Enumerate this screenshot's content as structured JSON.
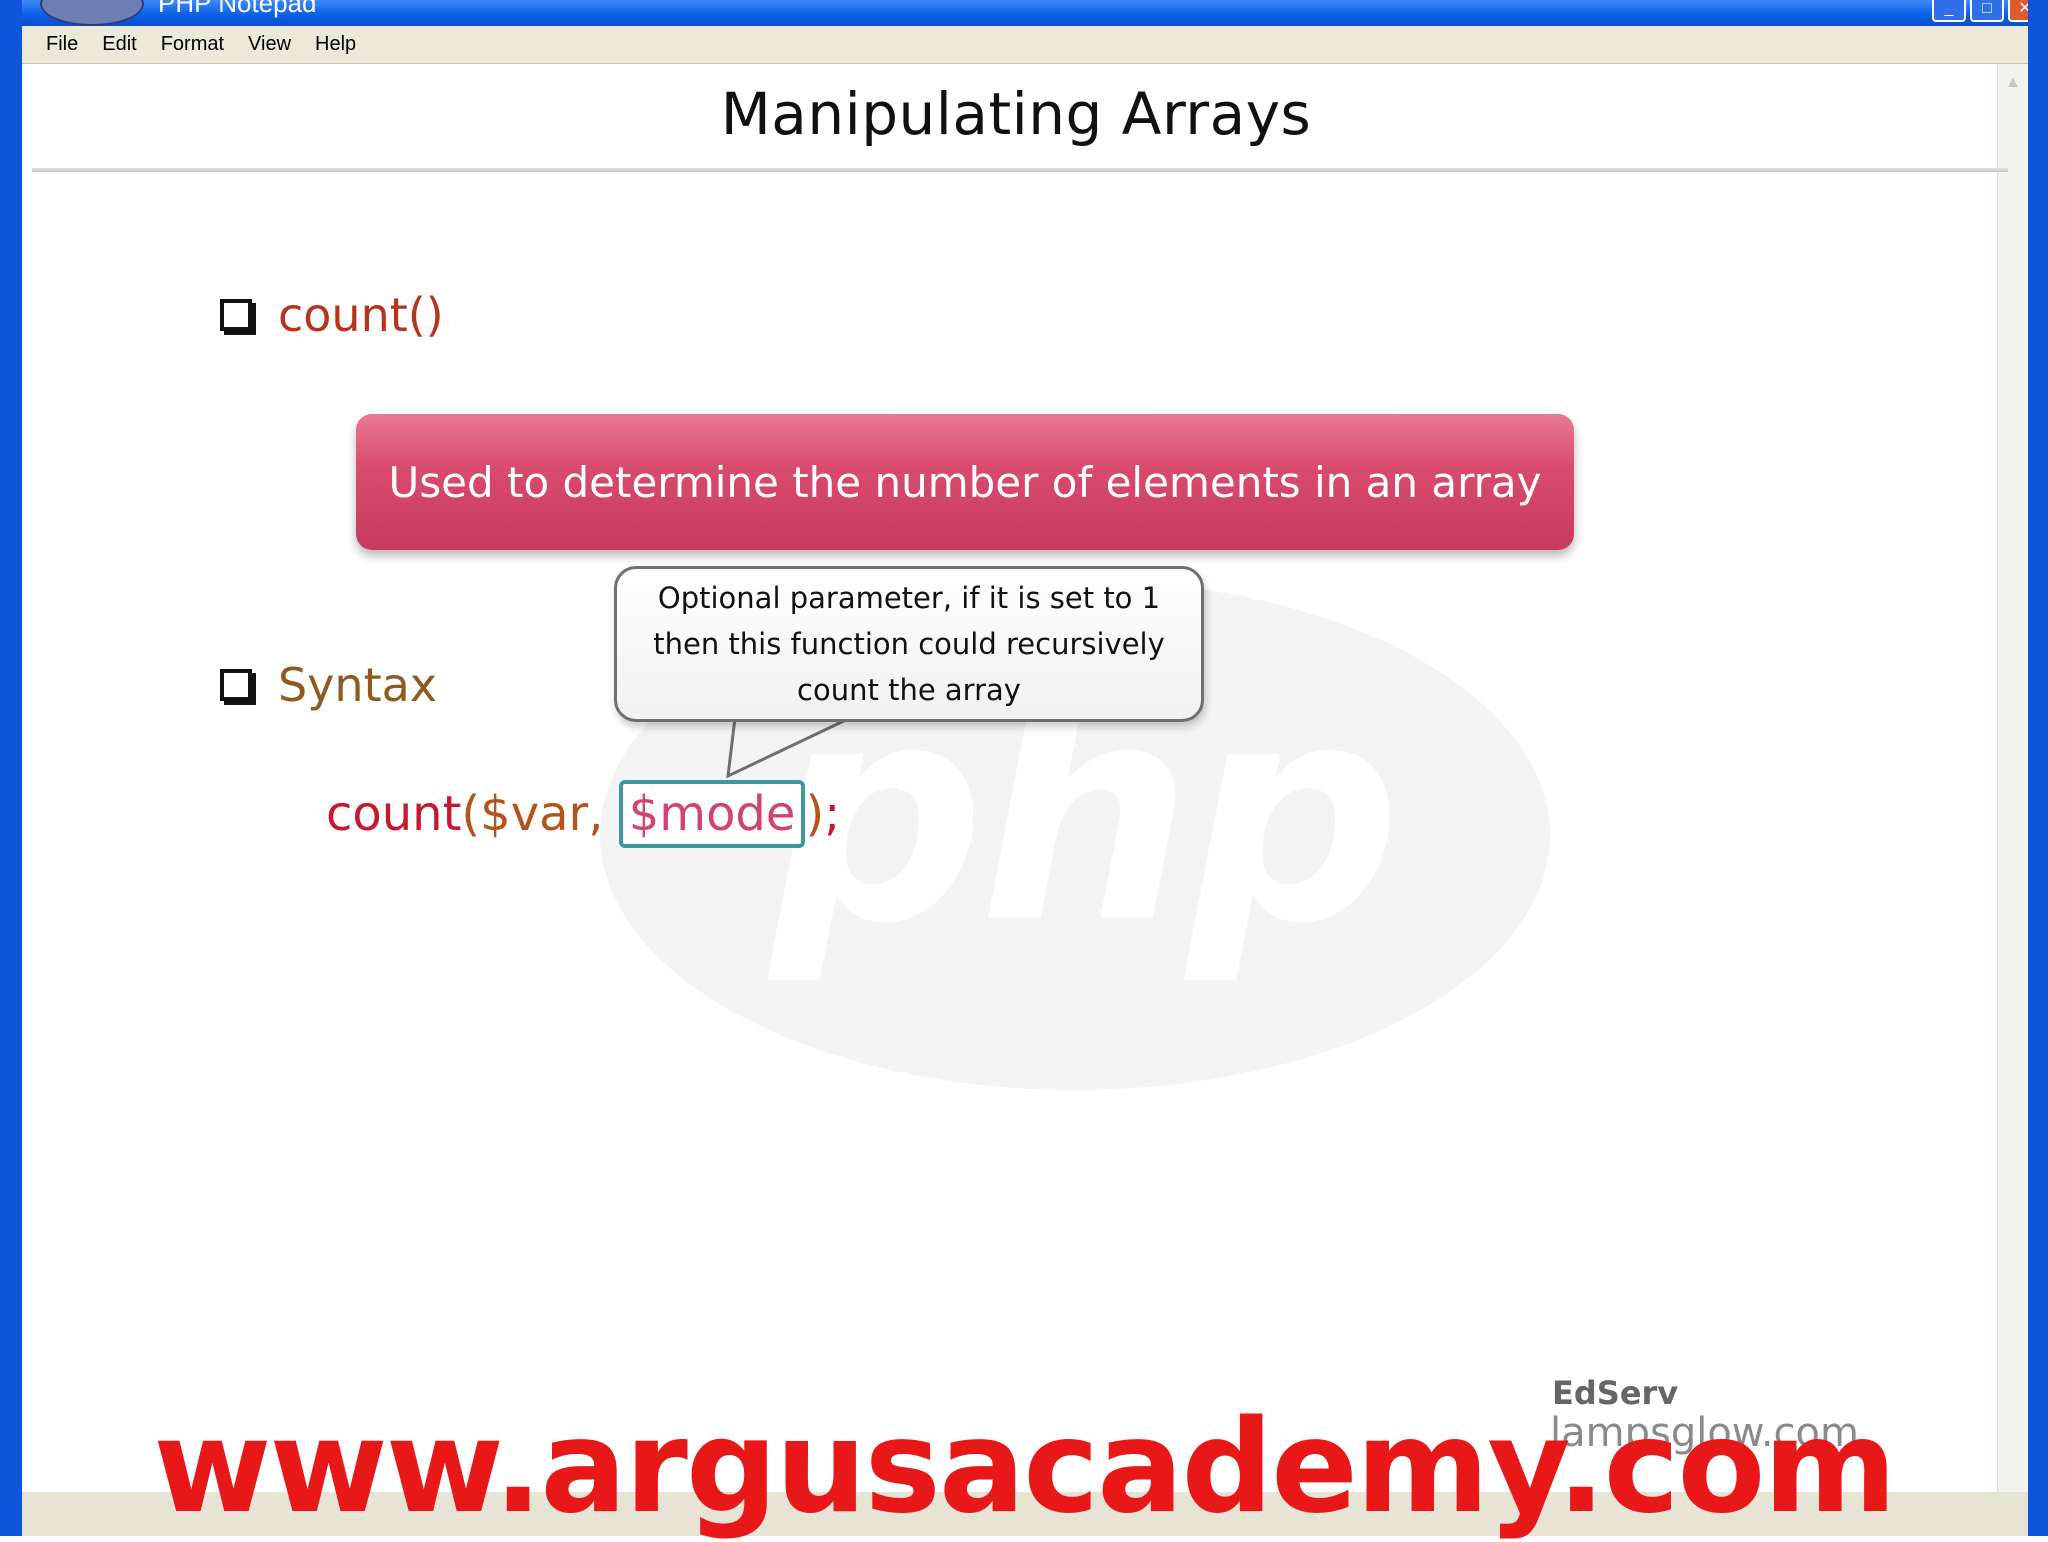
{
  "window": {
    "title": "PHP Notepad",
    "controls": [
      "_",
      "□",
      "✕"
    ]
  },
  "menubar": {
    "items": [
      "File",
      "Edit",
      "Format",
      "View",
      "Help"
    ]
  },
  "slide": {
    "title": "Manipulating Arrays",
    "bullets": [
      {
        "label": "count()"
      },
      {
        "label": "Syntax"
      }
    ],
    "definition": "Used to determine the number of elements in an array",
    "callout": {
      "line1": "Optional parameter, if it is set to 1",
      "line2": "then this function could recursively",
      "line3": "count the array"
    },
    "code": {
      "fn": "count",
      "open": "(",
      "var": "$var, ",
      "mode": "$mode",
      "close": ")",
      "semi": ";"
    },
    "watermark": "php"
  },
  "branding": {
    "edserv": "EdServ",
    "lamps": "lampsglow.com",
    "site": "www.argusacademy.com"
  },
  "colors": {
    "titlebar": "#0a5ee8",
    "definition_box": "#d84a6e",
    "bullet_count": "#b8331c",
    "bullet_syntax": "#8e5a1f",
    "code_fn": "#c6182f",
    "code_mode": "#d2436d",
    "banner": "#e81818"
  }
}
